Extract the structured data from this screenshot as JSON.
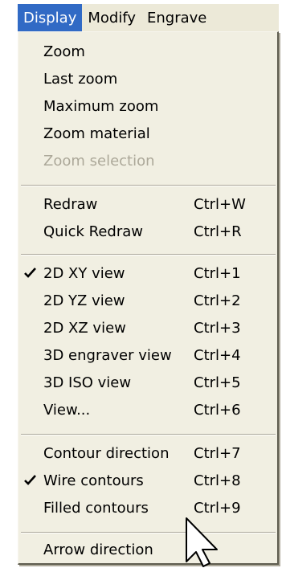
{
  "menubar": {
    "items": [
      {
        "label": "Display",
        "active": true
      },
      {
        "label": "Modify"
      },
      {
        "label": "Engrave"
      }
    ]
  },
  "menu": {
    "zoom": "Zoom",
    "last_zoom": "Last zoom",
    "maximum_zoom": "Maximum zoom",
    "zoom_material": "Zoom material",
    "zoom_selection": "Zoom selection",
    "redraw": {
      "label": "Redraw",
      "shortcut": "Ctrl+W"
    },
    "quick_redraw": {
      "label": "Quick Redraw",
      "shortcut": "Ctrl+R"
    },
    "view_2d_xy": {
      "label": "2D XY view",
      "shortcut": "Ctrl+1",
      "checked": true
    },
    "view_2d_yz": {
      "label": "2D YZ view",
      "shortcut": "Ctrl+2"
    },
    "view_2d_xz": {
      "label": "2D XZ view",
      "shortcut": "Ctrl+3"
    },
    "view_3d_engraver": {
      "label": "3D engraver view",
      "shortcut": "Ctrl+4"
    },
    "view_3d_iso": {
      "label": "3D ISO view",
      "shortcut": "Ctrl+5"
    },
    "view_dialog": {
      "label": "View...",
      "shortcut": "Ctrl+6"
    },
    "contour_direction": {
      "label": "Contour direction",
      "shortcut": "Ctrl+7"
    },
    "wire_contours": {
      "label": "Wire contours",
      "shortcut": "Ctrl+8",
      "checked": true
    },
    "filled_contours": {
      "label": "Filled contours",
      "shortcut": "Ctrl+9"
    },
    "arrow_direction": "Arrow direction"
  },
  "colors": {
    "menubar_bg": "#ece9d8",
    "menu_bg": "#f1efe2",
    "highlight": "#316ac5",
    "disabled_text": "#aca899"
  },
  "icons": {
    "check": "check-icon",
    "cursor": "mouse-pointer-icon"
  }
}
